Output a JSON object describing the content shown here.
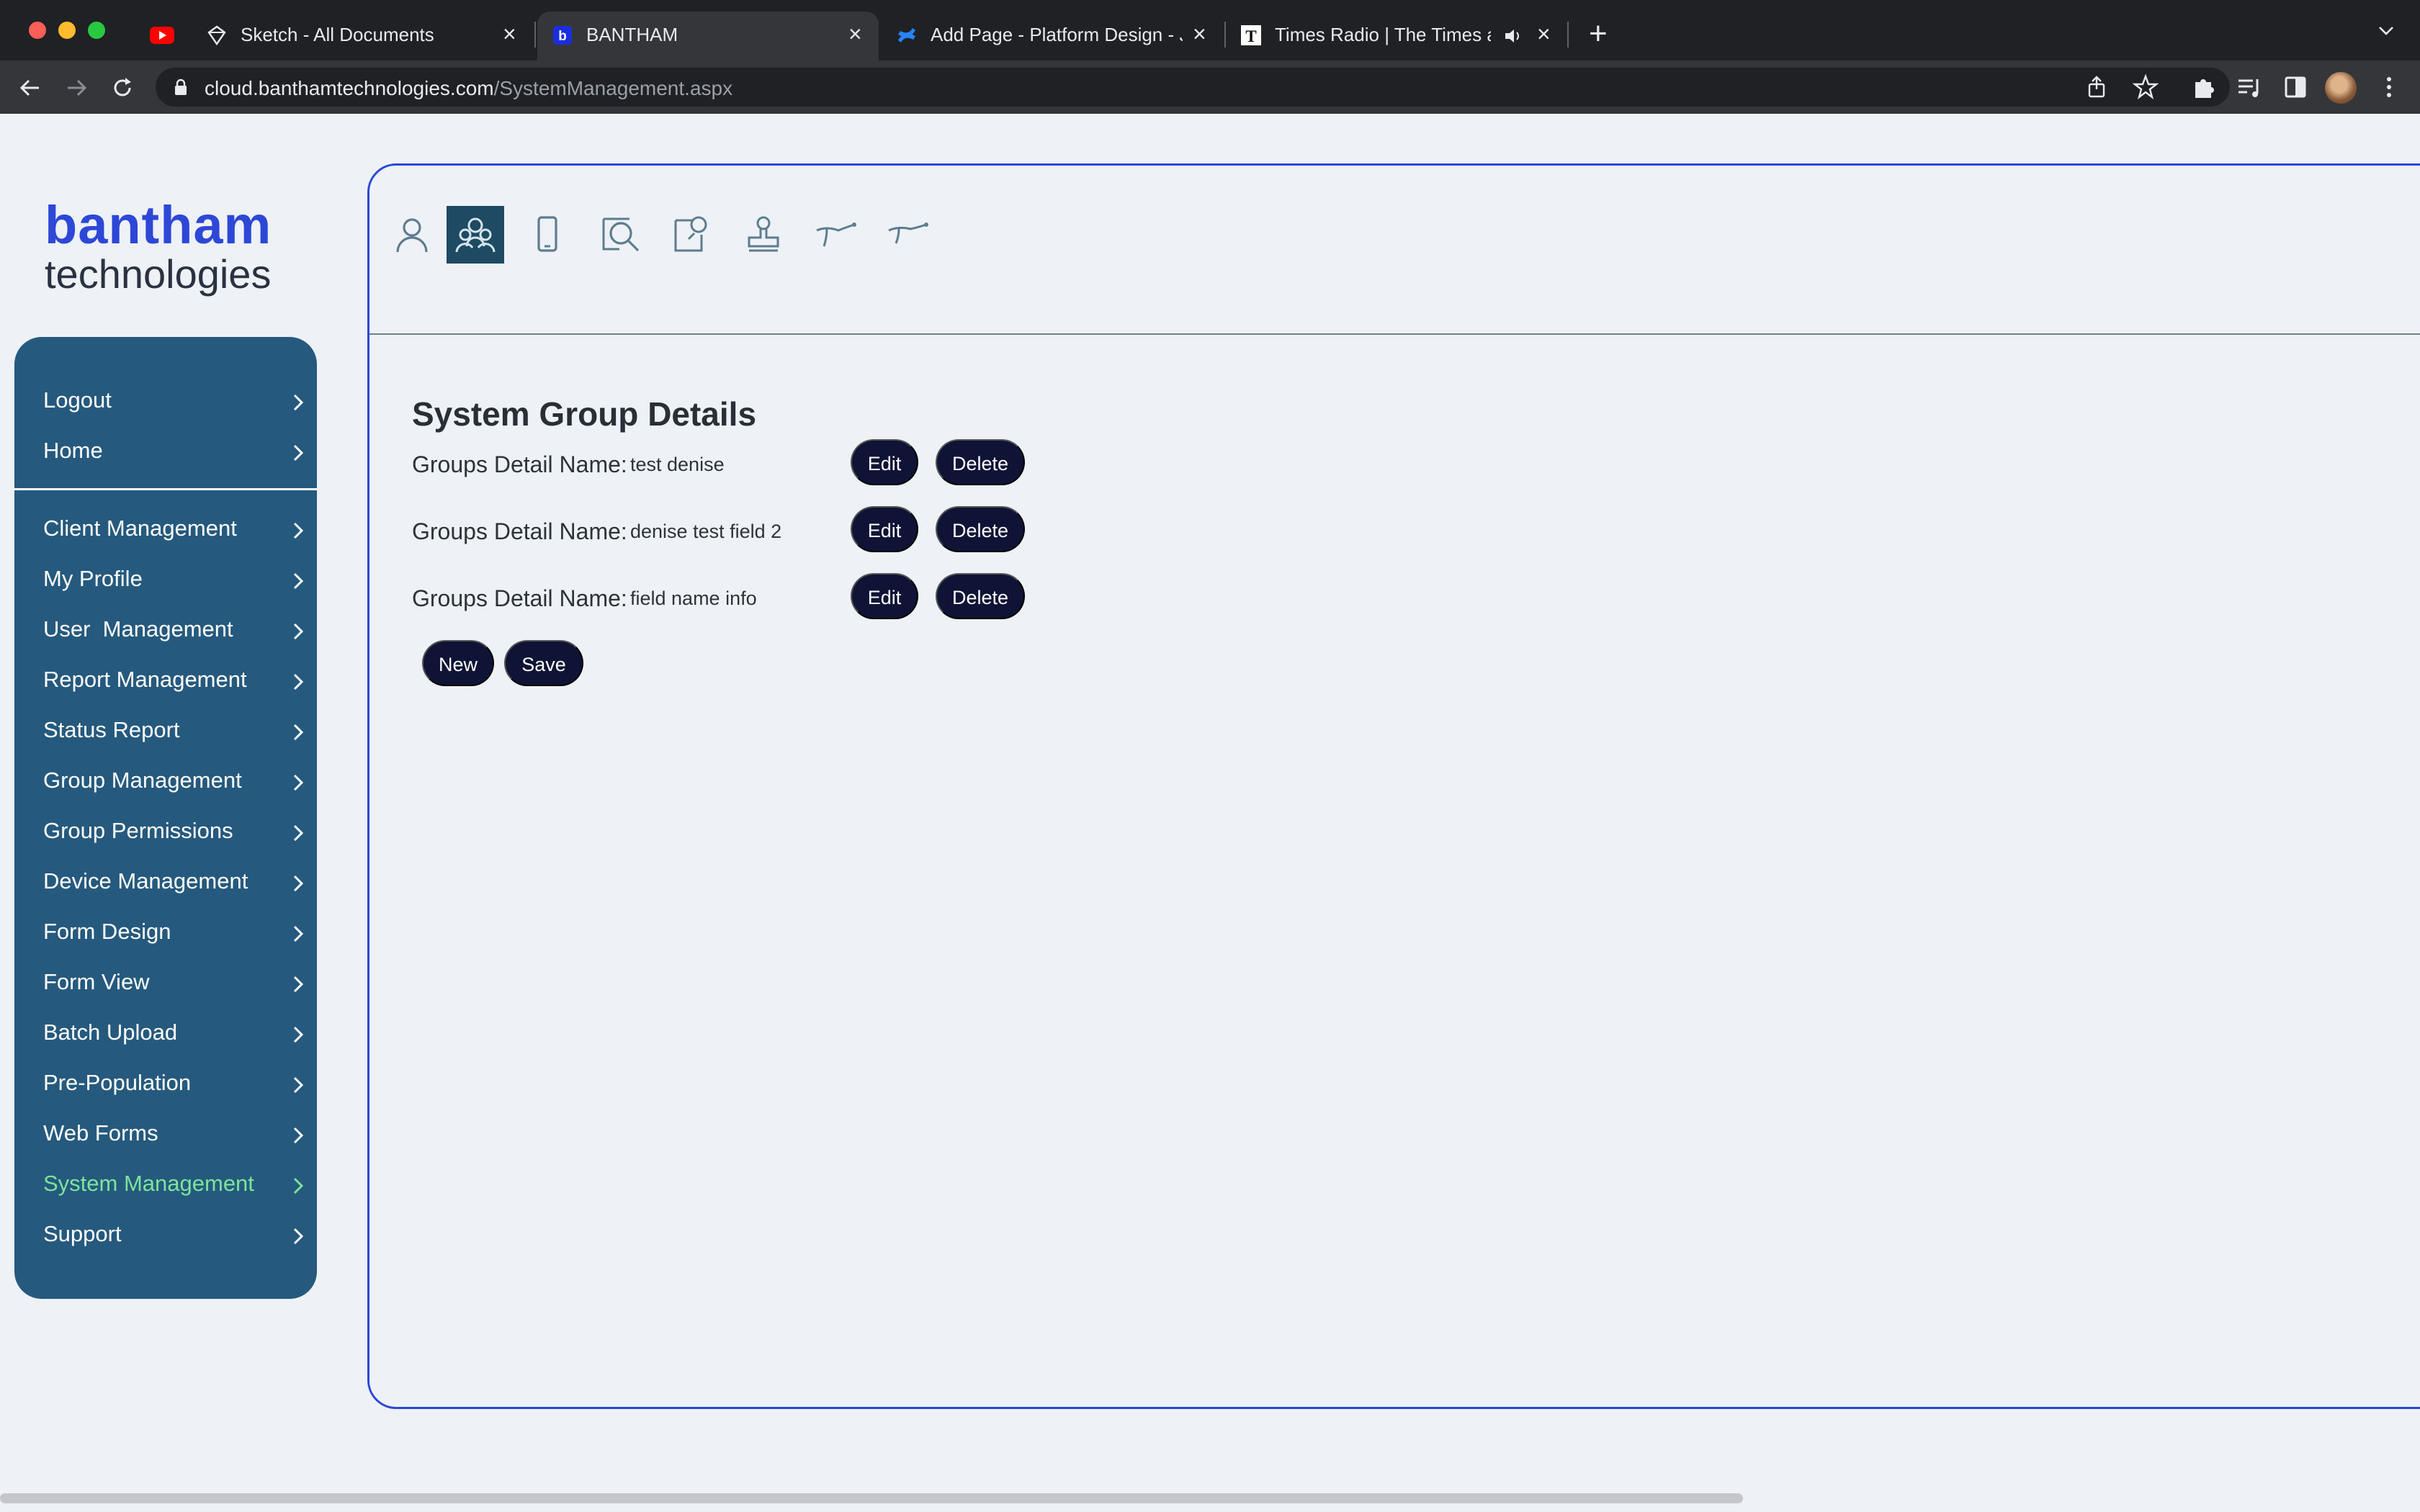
{
  "browser": {
    "tabs": [
      {
        "title": "Sketch - All Documents",
        "icon": "sketch-diamond-icon"
      },
      {
        "title": "BANTHAM",
        "icon": "bantham-b-icon"
      },
      {
        "title": "Add Page - Platform Design - J",
        "icon": "confluence-icon"
      },
      {
        "title": "Times Radio | The Times ar",
        "icon": "times-t-icon"
      }
    ],
    "url_host": "cloud.banthamtechnologies.com",
    "url_path": "/SystemManagement.aspx"
  },
  "logo": {
    "line1": "bantham",
    "line2": "technologies"
  },
  "sidebar": {
    "top_items": [
      {
        "label": "Logout"
      },
      {
        "label": "Home"
      }
    ],
    "items": [
      {
        "label": "Client Management"
      },
      {
        "label": "My Profile"
      },
      {
        "label": "User  Management"
      },
      {
        "label": "Report Management"
      },
      {
        "label": "Status Report"
      },
      {
        "label": "Group Management"
      },
      {
        "label": "Group Permissions"
      },
      {
        "label": "Device Management"
      },
      {
        "label": "Form Design"
      },
      {
        "label": "Form View"
      },
      {
        "label": "Batch Upload"
      },
      {
        "label": "Pre-Population"
      },
      {
        "label": "Web Forms"
      },
      {
        "label": "System Management"
      },
      {
        "label": "Support"
      }
    ],
    "active_item": "System Management"
  },
  "toolbar_icons": [
    "user-icon",
    "group-icon",
    "mobile-device-icon",
    "search-document-icon",
    "edit-document-icon",
    "stamp-icon",
    "branch-icon",
    "branch-alt-icon"
  ],
  "section": {
    "title": "System Group Details",
    "rows": [
      {
        "label": "Groups Detail Name:",
        "value": "test denise",
        "edit": "Edit",
        "delete": "Delete"
      },
      {
        "label": "Groups Detail Name:",
        "value": "denise test field 2",
        "edit": "Edit",
        "delete": "Delete"
      },
      {
        "label": "Groups Detail Name:",
        "value": "field name info",
        "edit": "Edit",
        "delete": "Delete"
      }
    ],
    "new_label": "New",
    "save_label": "Save"
  },
  "colors": {
    "sidebar_bg": "#255a7e",
    "active_item": "#7de39c",
    "button_bg": "#0f1437",
    "brand_blue": "#2d48d6"
  }
}
